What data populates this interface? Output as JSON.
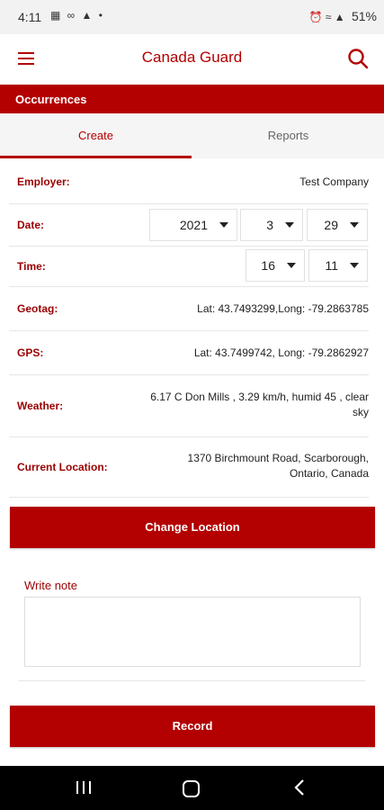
{
  "status_bar": {
    "time": "4:11",
    "battery": "51%"
  },
  "app_bar": {
    "title": "Canada Guard"
  },
  "section": {
    "title": "Occurrences"
  },
  "tabs": [
    {
      "label": "Create",
      "active": true
    },
    {
      "label": "Reports",
      "active": false
    }
  ],
  "form": {
    "employer": {
      "label": "Employer:",
      "value": "Test Company"
    },
    "date": {
      "label": "Date:",
      "year": "2021",
      "month": "3",
      "day": "29"
    },
    "time": {
      "label": "Time:",
      "hour": "16",
      "minute": "11"
    },
    "geotag": {
      "label": "Geotag:",
      "value": "Lat: 43.7493299,Long: -79.2863785"
    },
    "gps": {
      "label": "GPS:",
      "value": "Lat: 43.7499742, Long: -79.2862927"
    },
    "weather": {
      "label": "Weather:",
      "value_line1": "6.17 C Don Mills , 3.29 km/h, humid 45 , clear",
      "value_line2": "sky"
    },
    "current_location": {
      "label": "Current Location:",
      "value_line1": "1370 Birchmount Road, Scarborough,",
      "value_line2": "Ontario, Canada"
    }
  },
  "buttons": {
    "change_location": "Change Location",
    "record": "Record"
  },
  "note": {
    "label": "Write note",
    "value": ""
  },
  "colors": {
    "brand_red": "#b30000",
    "label_red": "#9b0000"
  },
  "icons": {
    "menu": "hamburger-menu-icon",
    "search": "search-icon",
    "nav_recents": "recents-icon",
    "nav_home": "home-icon",
    "nav_back": "back-icon"
  }
}
